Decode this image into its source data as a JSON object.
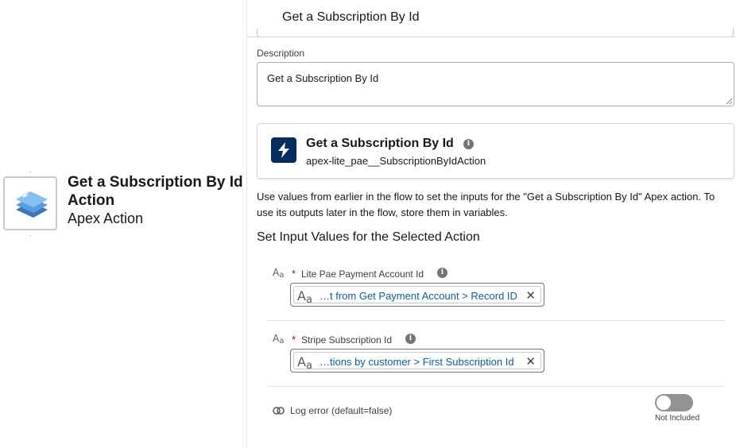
{
  "node": {
    "title": "Get a Subscription By Id Action",
    "subtitle": "Apex Action",
    "icon": "apex-action-stack-icon"
  },
  "header": {
    "title": "Get a Subscription By Id"
  },
  "description": {
    "label": "Description",
    "value": "Get a Subscription By Id"
  },
  "action_card": {
    "name": "Get a Subscription By Id",
    "api_name": "apex-lite_pae__SubscriptionByIdAction",
    "icon": "bolt-icon"
  },
  "help_text": "Use values from earlier in the flow to set the inputs for the \"Get a Subscription By Id\" Apex action. To use its outputs later in the flow, store them in variables.",
  "section_title": "Set Input Values for the Selected Action",
  "inputs": [
    {
      "label": "Lite Pae Payment Account Id",
      "required_mark": "*",
      "type_glyph": "A",
      "type_glyph_sub": "a",
      "pill_text": "…t from Get Payment Account > Record ID"
    },
    {
      "label": "Stripe Subscription Id",
      "required_mark": "*",
      "type_glyph": "A",
      "type_glyph_sub": "a",
      "pill_text": "…tions by customer > First Subscription Id"
    }
  ],
  "log_error": {
    "label": "Log error (default=false)",
    "toggle_status": "Not Included",
    "toggle_on": false
  },
  "colors": {
    "accent": "#0b5cab",
    "bolt_badge": "#032d60",
    "required": "#ba0517",
    "toggle_off": "#939393"
  }
}
